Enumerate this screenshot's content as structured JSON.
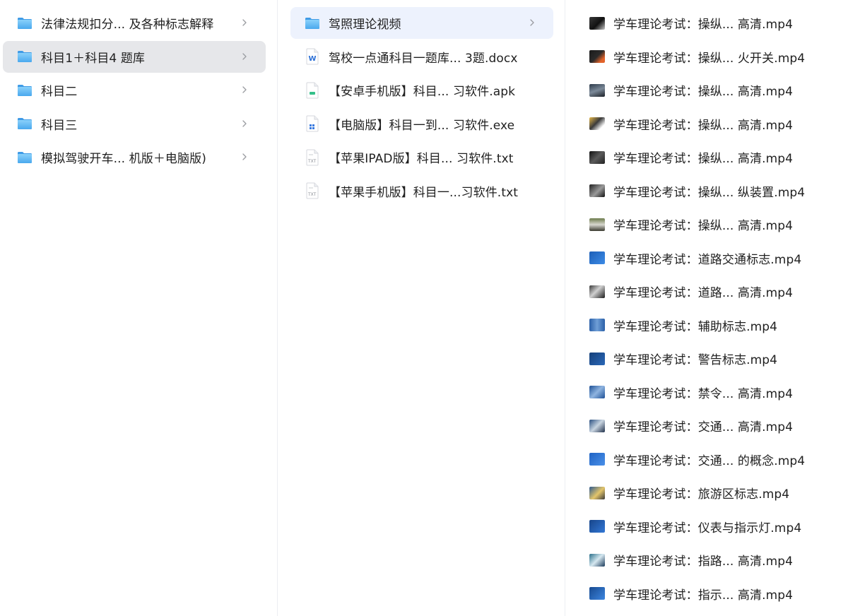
{
  "column1": {
    "items": [
      {
        "label": "法律法规扣分... 及各种标志解释",
        "icon": "folder-icon"
      },
      {
        "label": "科目1＋科目4 题库",
        "icon": "folder-icon"
      },
      {
        "label": "科目二",
        "icon": "folder-icon"
      },
      {
        "label": "科目三",
        "icon": "folder-icon"
      },
      {
        "label": "模拟驾驶开车... 机版＋电脑版)",
        "icon": "folder-icon"
      }
    ]
  },
  "column2": {
    "items": [
      {
        "label": "驾照理论视频",
        "icon": "folder-icon"
      },
      {
        "label": "驾校一点通科目一题库... 3题.docx",
        "icon": "word-doc-icon"
      },
      {
        "label": "【安卓手机版】科目...  习软件.apk",
        "icon": "apk-file-icon"
      },
      {
        "label": "【电脑版】科目一到...  习软件.exe",
        "icon": "exe-file-icon"
      },
      {
        "label": "【苹果IPAD版】科目...   习软件.txt",
        "icon": "txt-file-icon"
      },
      {
        "label": "【苹果手机版】科目一...习软件.txt",
        "icon": "txt-file-icon"
      }
    ]
  },
  "column3": {
    "items": [
      {
        "label": "学车理论考试：操纵...    高清.mp4",
        "icon": "video-thumbnail-icon"
      },
      {
        "label": "学车理论考试：操纵... 火开关.mp4",
        "icon": "video-thumbnail-icon"
      },
      {
        "label": "学车理论考试：操纵...    高清.mp4",
        "icon": "video-thumbnail-icon"
      },
      {
        "label": "学车理论考试：操纵...    高清.mp4",
        "icon": "video-thumbnail-icon"
      },
      {
        "label": "学车理论考试：操纵...    高清.mp4",
        "icon": "video-thumbnail-icon"
      },
      {
        "label": "学车理论考试：操纵... 纵装置.mp4",
        "icon": "video-thumbnail-icon"
      },
      {
        "label": "学车理论考试：操纵...    高清.mp4",
        "icon": "video-thumbnail-icon"
      },
      {
        "label": "学车理论考试：道路交通标志.mp4",
        "icon": "video-thumbnail-icon"
      },
      {
        "label": "学车理论考试：道路...    高清.mp4",
        "icon": "video-thumbnail-icon"
      },
      {
        "label": "学车理论考试：辅助标志.mp4",
        "icon": "video-thumbnail-icon"
      },
      {
        "label": "学车理论考试：警告标志.mp4",
        "icon": "video-thumbnail-icon"
      },
      {
        "label": "学车理论考试：禁令...    高清.mp4",
        "icon": "video-thumbnail-icon"
      },
      {
        "label": "学车理论考试：交通...    高清.mp4",
        "icon": "video-thumbnail-icon"
      },
      {
        "label": "学车理论考试：交通... 的概念.mp4",
        "icon": "video-thumbnail-icon"
      },
      {
        "label": "学车理论考试：旅游区标志.mp4",
        "icon": "video-thumbnail-icon"
      },
      {
        "label": "学车理论考试：仪表与指示灯.mp4",
        "icon": "video-thumbnail-icon"
      },
      {
        "label": "学车理论考试：指路...    高清.mp4",
        "icon": "video-thumbnail-icon"
      },
      {
        "label": "学车理论考试：指示...    高清.mp4",
        "icon": "video-thumbnail-icon"
      }
    ]
  },
  "colors": {
    "selected_background": "#e6e7ea",
    "highlight_background": "#edf2fd",
    "folder_blue": "#5eb8f5",
    "text": "#1f1f1f"
  }
}
